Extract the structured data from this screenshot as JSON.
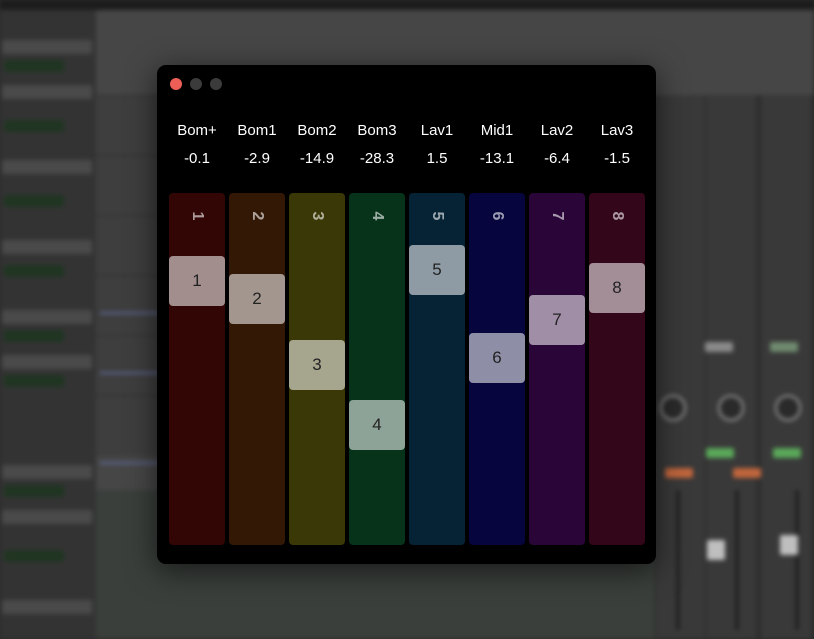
{
  "window": {
    "buttons": {
      "close": "close",
      "minimize": "minimize",
      "maximize": "maximize"
    }
  },
  "channels": [
    {
      "name": "Bom+",
      "value": "-0.1",
      "number": "1",
      "handle_label": "1",
      "color": "#330606",
      "level": 0.25
    },
    {
      "name": "Bom1",
      "value": "-2.9",
      "number": "2",
      "handle_label": "2",
      "color": "#331806",
      "level": 0.3
    },
    {
      "name": "Bom2",
      "value": "-14.9",
      "number": "3",
      "handle_label": "3",
      "color": "#3a3806",
      "level": 0.49
    },
    {
      "name": "Bom3",
      "value": "-28.3",
      "number": "4",
      "handle_label": "4",
      "color": "#06331a",
      "level": 0.66
    },
    {
      "name": "Lav1",
      "value": "1.5",
      "number": "5",
      "handle_label": "5",
      "color": "#062336",
      "level": 0.22
    },
    {
      "name": "Mid1",
      "value": "-13.1",
      "number": "6",
      "handle_label": "6",
      "color": "#06053d",
      "level": 0.47
    },
    {
      "name": "Lav2",
      "value": "-6.4",
      "number": "7",
      "handle_label": "7",
      "color": "#2a0638",
      "level": 0.36
    },
    {
      "name": "Lav3",
      "value": "-1.5",
      "number": "8",
      "handle_label": "8",
      "color": "#33061a",
      "level": 0.27
    }
  ],
  "colors": {
    "close_button": "#ed5e57",
    "inactive_button": "#3b3b3b",
    "window_background": "#000000",
    "handle": "rgba(255,255,255,0.55)"
  }
}
